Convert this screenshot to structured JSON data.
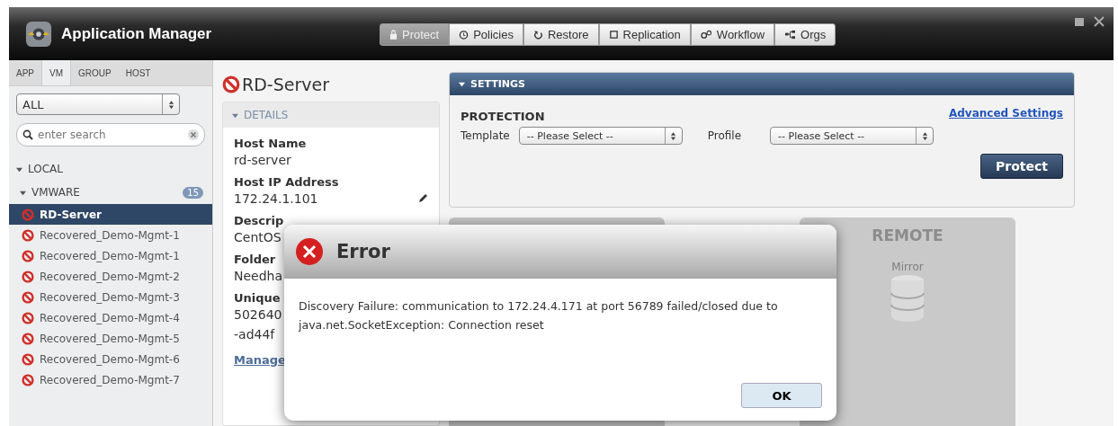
{
  "window": {
    "title": "Application Manager"
  },
  "nav_tabs": [
    {
      "label": "Protect",
      "selected": true
    },
    {
      "label": "Policies",
      "selected": false
    },
    {
      "label": "Restore",
      "selected": false
    },
    {
      "label": "Replication",
      "selected": false
    },
    {
      "label": "Workflow",
      "selected": false
    },
    {
      "label": "Orgs",
      "selected": false
    }
  ],
  "sidebar": {
    "tabs": [
      {
        "label": "APP",
        "selected": false
      },
      {
        "label": "VM",
        "selected": true
      },
      {
        "label": "GROUP",
        "selected": false
      },
      {
        "label": "HOST",
        "selected": false
      }
    ],
    "filter": "ALL",
    "search": {
      "placeholder": "enter search"
    },
    "tree": [
      {
        "label": "LOCAL",
        "expanded": true,
        "children": [
          {
            "label": "VMWARE",
            "expanded": true,
            "count": "15",
            "children": [
              {
                "label": "RD-Server",
                "selected": true
              },
              {
                "label": "Recovered_Demo-Mgmt-1",
                "selected": false
              },
              {
                "label": "Recovered_Demo-Mgmt-1",
                "selected": false
              },
              {
                "label": "Recovered_Demo-Mgmt-2",
                "selected": false
              },
              {
                "label": "Recovered_Demo-Mgmt-3",
                "selected": false
              },
              {
                "label": "Recovered_Demo-Mgmt-4",
                "selected": false
              },
              {
                "label": "Recovered_Demo-Mgmt-5",
                "selected": false
              },
              {
                "label": "Recovered_Demo-Mgmt-6",
                "selected": false
              },
              {
                "label": "Recovered_Demo-Mgmt-7",
                "selected": false
              }
            ]
          }
        ]
      }
    ]
  },
  "server": {
    "name": "RD-Server"
  },
  "details": {
    "title": "DETAILS",
    "expanded": true,
    "fields": [
      {
        "label": "Host Name",
        "value": "rd-server",
        "editable": false
      },
      {
        "label": "Host IP Address",
        "value": "172.24.1.101",
        "editable": true
      },
      {
        "label": "Descrip",
        "value": "CentOS",
        "editable": false
      },
      {
        "label": "Folder",
        "value": "Needha",
        "editable": false
      },
      {
        "label": "Unique",
        "value": "502640",
        "value_2": "-ad44f",
        "editable": false
      }
    ],
    "link": "Manage"
  },
  "settings": {
    "title": "SETTINGS",
    "expanded": true,
    "section": "PROTECTION",
    "advanced_link": "Advanced Settings",
    "template": {
      "label": "Template",
      "value": "-- Please Select --"
    },
    "profile": {
      "label": "Profile",
      "value": "-- Please Select --"
    },
    "button": "Protect"
  },
  "remote": {
    "title": "REMOTE",
    "mode": "Mirror"
  },
  "dialog": {
    "title": "Error",
    "message": "Discovery Failure: communication to 172.24.4.171 at port 56789 failed/closed due to java.net.SocketException: Connection reset",
    "button": "OK"
  }
}
